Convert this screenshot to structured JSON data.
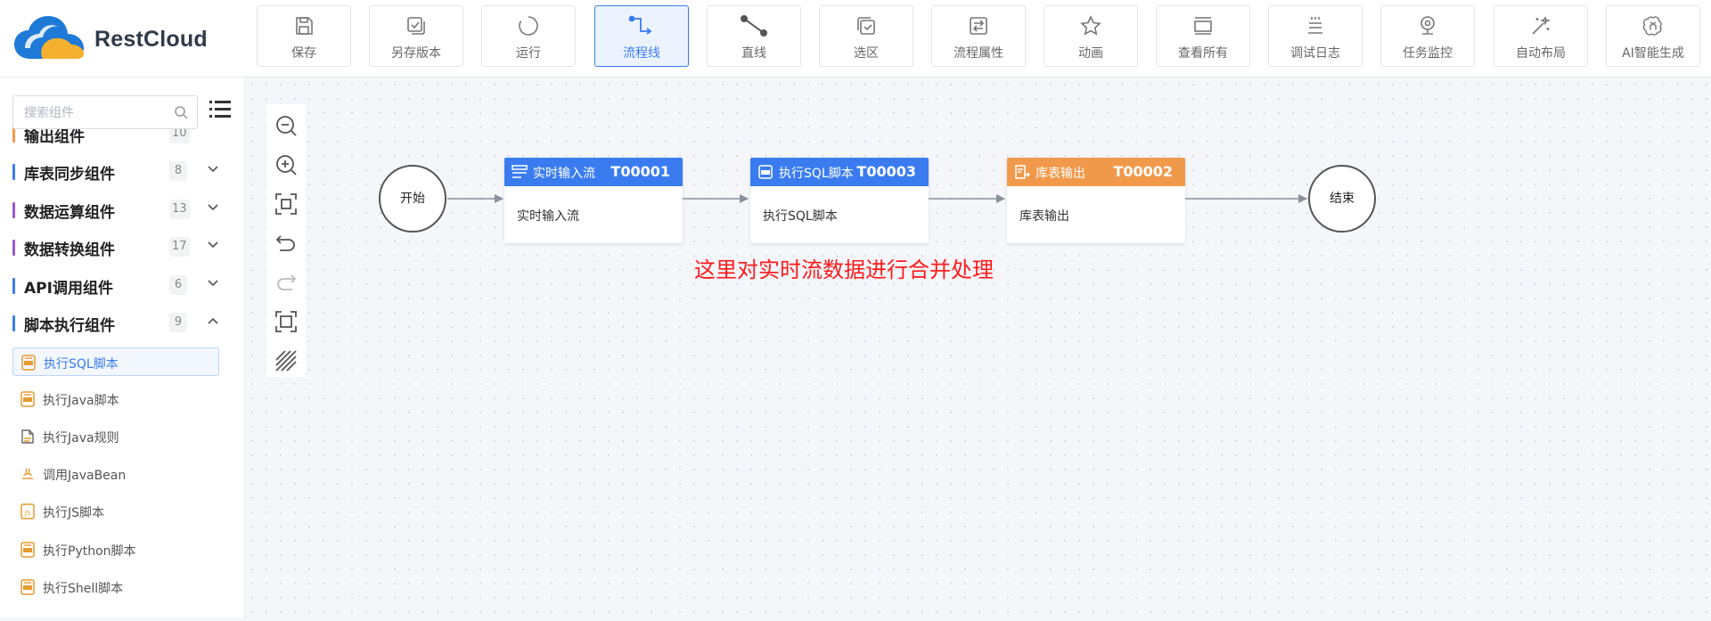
{
  "app": {
    "name": "RestCloud"
  },
  "toolbar": {
    "buttons": [
      {
        "label": "保存",
        "icon": "save-icon"
      },
      {
        "label": "另存版本",
        "icon": "save-version-icon"
      },
      {
        "label": "运行",
        "icon": "run-icon"
      },
      {
        "label": "流程线",
        "icon": "flow-line-icon",
        "active": true
      },
      {
        "label": "直线",
        "icon": "straight-line-icon"
      },
      {
        "label": "选区",
        "icon": "select-area-icon"
      },
      {
        "label": "流程属性",
        "icon": "flow-properties-icon"
      },
      {
        "label": "动画",
        "icon": "animation-icon"
      },
      {
        "label": "查看所有",
        "icon": "view-all-icon"
      },
      {
        "label": "调试日志",
        "icon": "debug-log-icon"
      },
      {
        "label": "任务监控",
        "icon": "task-monitor-icon"
      },
      {
        "label": "自动布局",
        "icon": "auto-layout-icon"
      },
      {
        "label": "AI智能生成",
        "icon": "ai-generate-icon"
      }
    ],
    "accent": "#3a7cf0"
  },
  "sidebar": {
    "search_placeholder": "搜索组件",
    "groups": [
      {
        "label": "输出组件",
        "count": "10",
        "expanded": false
      },
      {
        "label": "库表同步组件",
        "count": "8",
        "expanded": false
      },
      {
        "label": "数据运算组件",
        "count": "13",
        "expanded": false
      },
      {
        "label": "数据转换组件",
        "count": "17",
        "expanded": false
      },
      {
        "label": "API调用组件",
        "count": "6",
        "expanded": false
      },
      {
        "label": "脚本执行组件",
        "count": "9",
        "expanded": true
      }
    ],
    "items": [
      {
        "label": "执行SQL脚本",
        "icon": "sql-script-icon",
        "active": true
      },
      {
        "label": "执行Java脚本",
        "icon": "java-script-icon"
      },
      {
        "label": "执行Java规则",
        "icon": "java-rule-icon"
      },
      {
        "label": "调用JavaBean",
        "icon": "javabean-icon"
      },
      {
        "label": "执行JS脚本",
        "icon": "js-script-icon"
      },
      {
        "label": "执行Python脚本",
        "icon": "python-script-icon"
      },
      {
        "label": "执行Shell脚本",
        "icon": "shell-script-icon"
      }
    ]
  },
  "canvas": {
    "zoom_tools": [
      "zoom-out-icon",
      "zoom-in-icon",
      "fit-view-icon",
      "undo-icon",
      "redo-icon",
      "fullscreen-icon",
      "grid-toggle-icon"
    ],
    "flow": {
      "start": {
        "label": "开始"
      },
      "end": {
        "label": "结束"
      },
      "nodes": [
        {
          "title": "实时输入流",
          "id": "T00001",
          "body": "实时输入流",
          "color": "#3a7cf0",
          "icon": "stream-input-icon"
        },
        {
          "title": "执行SQL脚本",
          "id": "T00003",
          "body": "执行SQL脚本",
          "color": "#3a7cf0",
          "icon": "sql-script-icon"
        },
        {
          "title": "库表输出",
          "id": "T00002",
          "body": "库表输出",
          "color": "#f0994b",
          "icon": "table-output-icon"
        }
      ]
    },
    "annotation": "这里对实时流数据进行合并处理"
  }
}
